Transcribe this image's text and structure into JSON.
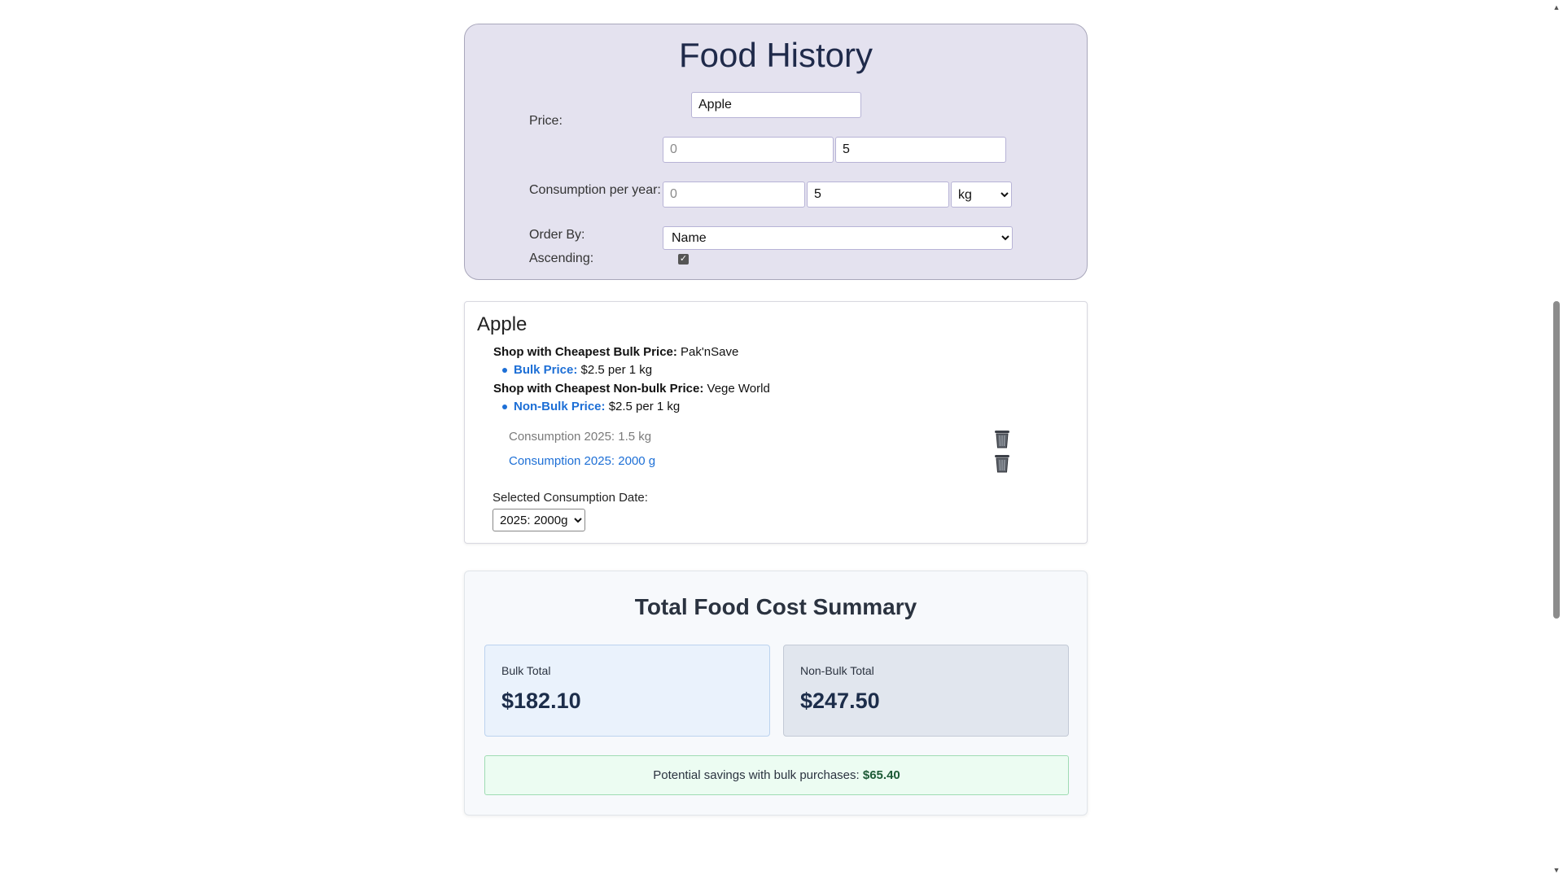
{
  "filters": {
    "title": "Food History",
    "name_value": "Apple",
    "price_label": "Price:",
    "price_min_placeholder": "0",
    "price_max_value": "5",
    "consumption_label": "Consumption per year:",
    "consumption_min_placeholder": "0",
    "consumption_max_value": "5",
    "unit_selected": "kg",
    "order_by_label": "Order By:",
    "order_by_selected": "Name",
    "ascending_label": "Ascending:",
    "ascending_checked": true
  },
  "food_item": {
    "name": "Apple",
    "bulk_shop_label": "Shop with Cheapest Bulk Price:",
    "bulk_shop_value": "Pak'nSave",
    "bulk_price_label": "Bulk Price:",
    "bulk_price_value": "$2.5 per 1 kg",
    "nonbulk_shop_label": "Shop with Cheapest Non-bulk Price:",
    "nonbulk_shop_value": "Vege World",
    "nonbulk_price_label": "Non-Bulk Price:",
    "nonbulk_price_value": "$2.5 per 1 kg",
    "consumptions": [
      {
        "text": "Consumption 2025: 1.5 kg",
        "color": "#7a7a7a"
      },
      {
        "text": "Consumption 2025: 2000 g",
        "color": "#1d6fd6"
      }
    ],
    "date_label": "Selected Consumption Date:",
    "date_selected": "2025: 2000g"
  },
  "summary": {
    "title": "Total Food Cost Summary",
    "bulk_label": "Bulk Total",
    "bulk_value": "$182.10",
    "nonbulk_label": "Non-Bulk Total",
    "nonbulk_value": "$247.50",
    "savings_text": "Potential savings with bulk purchases:",
    "savings_value": "$65.40"
  },
  "icons": {
    "trash": "trash-can-icon",
    "scroll_up": "scroll-up-arrow-icon",
    "scroll_down": "scroll-down-arrow-icon"
  }
}
